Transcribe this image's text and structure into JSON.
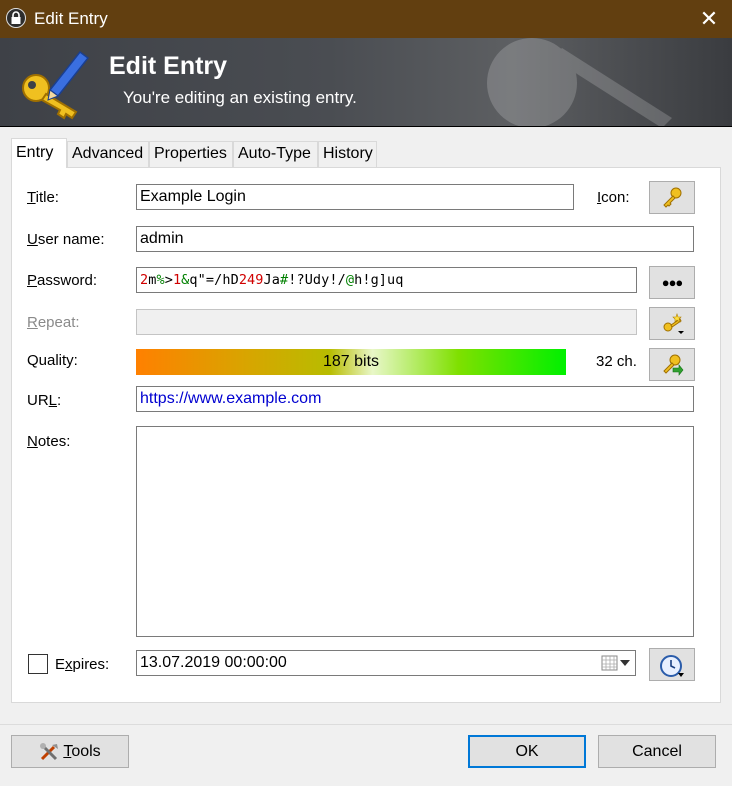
{
  "window": {
    "title": "Edit Entry",
    "close_glyph": "✕"
  },
  "banner": {
    "title": "Edit Entry",
    "subtitle": "You're editing an existing entry."
  },
  "tabs": [
    {
      "label": "Entry",
      "active": true
    },
    {
      "label": "Advanced"
    },
    {
      "label": "Properties"
    },
    {
      "label": "Auto-Type"
    },
    {
      "label": "History"
    }
  ],
  "form": {
    "title": {
      "label_acc": "T",
      "label_rest": "itle:",
      "value": "Example Login"
    },
    "icon": {
      "label_acc": "I",
      "label_rest": "con:",
      "icon": "key-icon"
    },
    "username": {
      "label_acc": "U",
      "label_rest": "ser name:",
      "value": "admin"
    },
    "password": {
      "label_acc": "P",
      "label_rest": "assword:",
      "value": "2m%>1&q\"=/hD249Ja#!?Udy!/@h!g]uq",
      "show_button_glyph": "●●●",
      "colors": {
        "digit": "#d00000",
        "symbol": "#008000",
        "letter": "#000000"
      }
    },
    "repeat": {
      "label_acc": "R",
      "label_rest": "epeat:",
      "value": ""
    },
    "quality": {
      "label": "Quality:",
      "value_text": "187 bits",
      "length_text": "32 ch."
    },
    "url": {
      "label_acc": "L",
      "label_pre": "UR",
      "label_post": ":",
      "value": "https://www.example.com"
    },
    "notes": {
      "label_acc": "N",
      "label_rest": "otes:",
      "value": ""
    },
    "expires": {
      "label_acc": "x",
      "label_pre": "E",
      "label_post": "pires:",
      "checked": false,
      "value": "13.07.2019 00:00:00"
    }
  },
  "footer": {
    "tools": {
      "label_acc": "T",
      "label_rest": "ools"
    },
    "ok": "OK",
    "cancel": "Cancel"
  },
  "colors": {
    "titlebar": "#623f10",
    "url": "#0000d0",
    "default_border": "#0078d7"
  }
}
